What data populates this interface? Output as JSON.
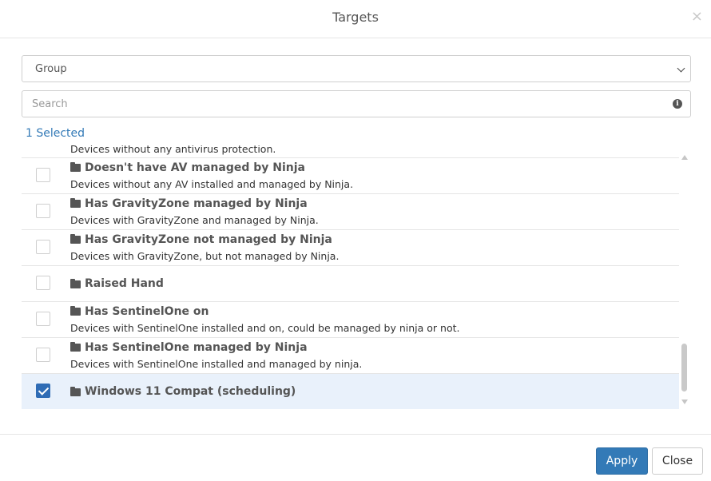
{
  "modal": {
    "title": "Targets",
    "close_glyph": "×"
  },
  "filter": {
    "selected_value": "Group"
  },
  "search": {
    "placeholder": "Search",
    "value": "",
    "info_glyph": "i"
  },
  "selection": {
    "count_label": "1 Selected"
  },
  "list": {
    "partial_description": "Devices without any antivirus protection.",
    "items": [
      {
        "name": "Doesn't have AV managed by Ninja",
        "description": "Devices without any AV installed and managed by Ninja.",
        "checked": false
      },
      {
        "name": "Has GravityZone managed by Ninja",
        "description": "Devices with GravityZone and managed by Ninja.",
        "checked": false
      },
      {
        "name": "Has GravityZone not managed by Ninja",
        "description": "Devices with GravityZone, but not managed by Ninja.",
        "checked": false
      },
      {
        "name": "Raised Hand",
        "description": "",
        "checked": false
      },
      {
        "name": "Has SentinelOne on",
        "description": "Devices with SentinelOne installed and on, could be managed by ninja or not.",
        "checked": false
      },
      {
        "name": "Has SentinelOne managed by Ninja",
        "description": "Devices with SentinelOne installed and managed by ninja.",
        "checked": false
      },
      {
        "name": "Windows 11 Compat (scheduling)",
        "description": "",
        "checked": true
      }
    ]
  },
  "footer": {
    "apply_label": "Apply",
    "close_label": "Close"
  },
  "colors": {
    "primary": "#337ab7",
    "checkbox_checked": "#2f6cb5",
    "selected_row": "#e9f1fb"
  },
  "icons": {
    "row_icon": "folder-icon",
    "close": "close-icon",
    "info": "info-icon",
    "dropdown": "chevron-down-icon"
  }
}
